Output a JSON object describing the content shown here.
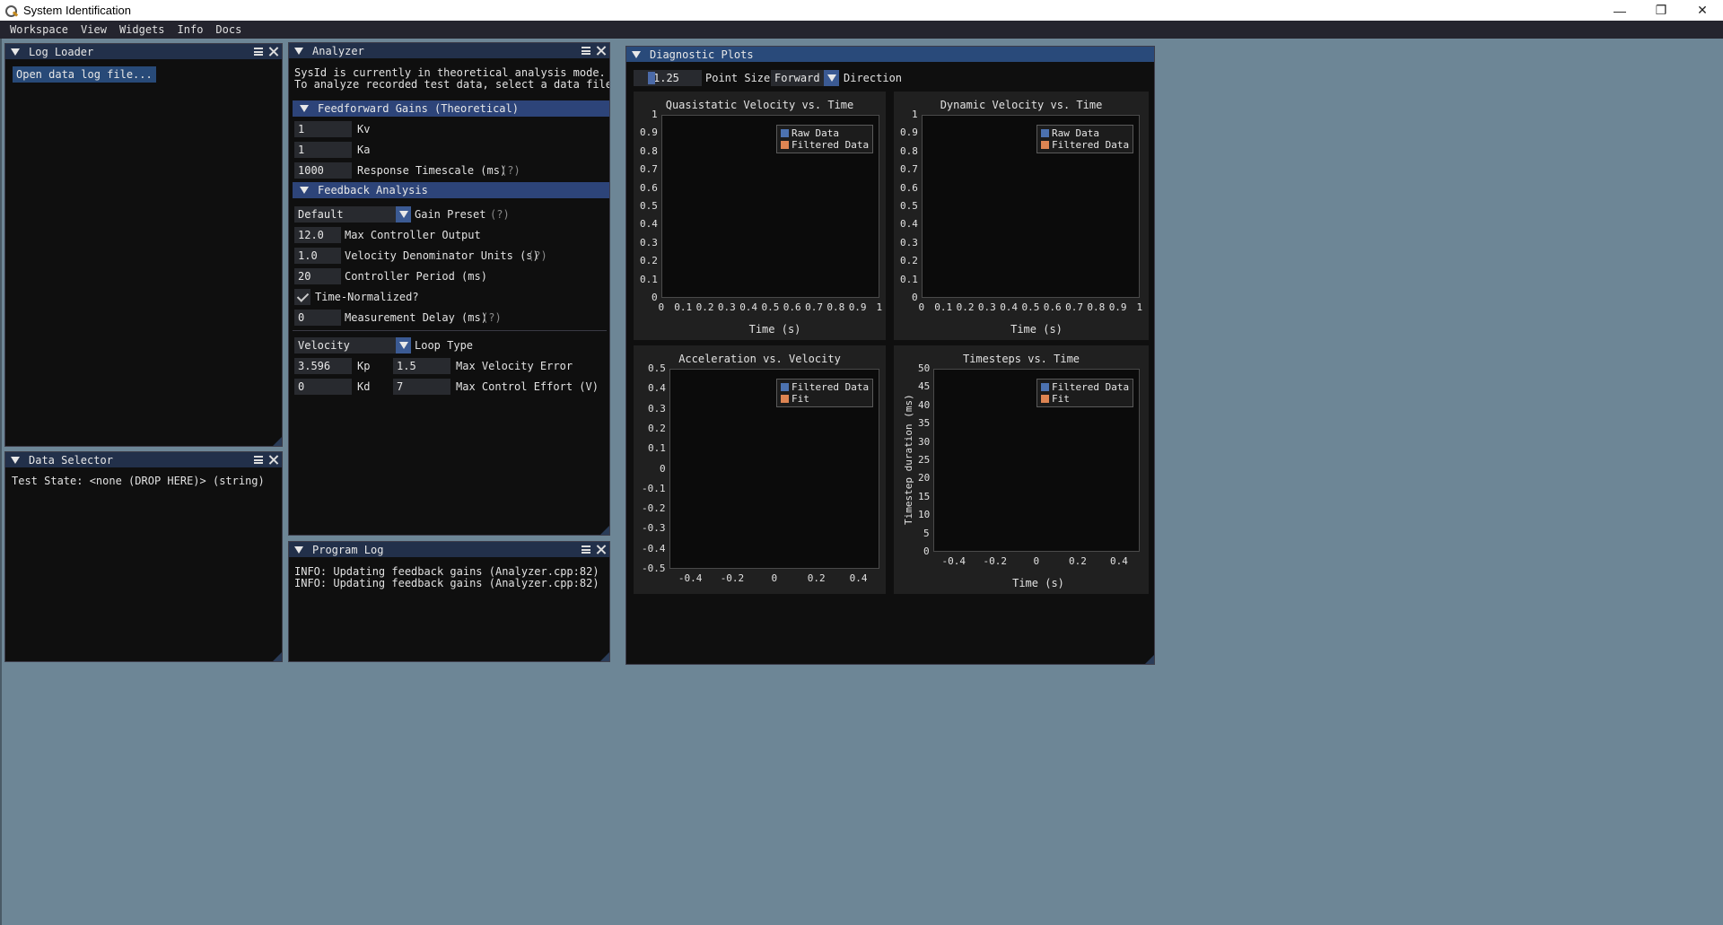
{
  "window": {
    "title": "System Identification",
    "controls": [
      "—",
      "❐",
      "✕"
    ]
  },
  "menu": [
    "Workspace",
    "View",
    "Widgets",
    "Info",
    "Docs"
  ],
  "log_loader": {
    "title": "Log Loader",
    "open_button": "Open data log file..."
  },
  "data_selector": {
    "title": "Data Selector",
    "test_state": "Test State: <none (DROP HERE)> (string)"
  },
  "analyzer": {
    "title": "Analyzer",
    "info_line1": "SysId is currently in theoretical analysis mode.",
    "info_line2": "To analyze recorded test data, select a data file (.wpil",
    "feedforward_header": "Feedforward Gains (Theoretical)",
    "kv": {
      "value": "1",
      "label": "Kv"
    },
    "ka": {
      "value": "1",
      "label": "Ka"
    },
    "response_timescale": {
      "value": "1000",
      "label": "Response Timescale (ms)",
      "help": "(?)"
    },
    "feedback_header": "Feedback Analysis",
    "gain_preset": {
      "value": "Default",
      "label": "Gain Preset",
      "help": "(?)"
    },
    "max_controller_output": {
      "value": "12.0",
      "label": "Max Controller Output"
    },
    "velocity_denominator": {
      "value": "1.0",
      "label": "Velocity Denominator Units (s)",
      "help": "(?)"
    },
    "controller_period": {
      "value": "20",
      "label": "Controller Period (ms)"
    },
    "time_normalized": {
      "label": "Time-Normalized?",
      "checked": true
    },
    "measurement_delay": {
      "value": "0",
      "label": "Measurement Delay (ms)",
      "help": "(?)"
    },
    "loop_type": {
      "value": "Velocity",
      "label": "Loop Type"
    },
    "kp": {
      "value": "3.596",
      "label": "Kp"
    },
    "kd": {
      "value": "0",
      "label": "Kd"
    },
    "max_velocity_error": {
      "value": "1.5",
      "label": "Max Velocity Error"
    },
    "max_control_effort": {
      "value": "7",
      "label": "Max Control Effort (V)"
    }
  },
  "program_log": {
    "title": "Program Log",
    "lines": [
      "INFO: Updating feedback gains (Analyzer.cpp:82)",
      "INFO: Updating feedback gains (Analyzer.cpp:82)"
    ]
  },
  "diagnostic": {
    "title": "Diagnostic Plots",
    "point_size": {
      "value": "1.25",
      "label": "Point Size"
    },
    "direction": {
      "value": "Forward",
      "label": "Direction"
    }
  },
  "colors": {
    "raw": "#4c72b0",
    "filtered": "#4c72b0",
    "filtered2": "#dd8452"
  },
  "chart_data": [
    {
      "type": "scatter",
      "title": "Quasistatic Velocity vs. Time",
      "xlabel": "Time (s)",
      "ylabel": "",
      "xticks": [
        "0",
        "0.1",
        "0.2",
        "0.3",
        "0.4",
        "0.5",
        "0.6",
        "0.7",
        "0.8",
        "0.9",
        "1"
      ],
      "yticks": [
        "0",
        "0.1",
        "0.2",
        "0.3",
        "0.4",
        "0.5",
        "0.6",
        "0.7",
        "0.8",
        "0.9",
        "1"
      ],
      "xlim": [
        0,
        1
      ],
      "ylim": [
        0,
        1
      ],
      "series": [
        {
          "name": "Raw Data",
          "x": [],
          "y": []
        },
        {
          "name": "Filtered Data",
          "x": [],
          "y": []
        }
      ],
      "legend": "top-right"
    },
    {
      "type": "scatter",
      "title": "Dynamic Velocity vs. Time",
      "xlabel": "Time (s)",
      "ylabel": "",
      "xticks": [
        "0",
        "0.1",
        "0.2",
        "0.3",
        "0.4",
        "0.5",
        "0.6",
        "0.7",
        "0.8",
        "0.9",
        "1"
      ],
      "yticks": [
        "0",
        "0.1",
        "0.2",
        "0.3",
        "0.4",
        "0.5",
        "0.6",
        "0.7",
        "0.8",
        "0.9",
        "1"
      ],
      "xlim": [
        0,
        1
      ],
      "ylim": [
        0,
        1
      ],
      "series": [
        {
          "name": "Raw Data",
          "x": [],
          "y": []
        },
        {
          "name": "Filtered Data",
          "x": [],
          "y": []
        }
      ],
      "legend": "top-right"
    },
    {
      "type": "scatter",
      "title": "Acceleration vs. Velocity",
      "xlabel": "",
      "ylabel": "",
      "xticks": [
        "-0.4",
        "-0.2",
        "0",
        "0.2",
        "0.4"
      ],
      "yticks": [
        "-0.5",
        "-0.4",
        "-0.3",
        "-0.2",
        "-0.1",
        "0",
        "0.1",
        "0.2",
        "0.3",
        "0.4",
        "0.5"
      ],
      "xlim": [
        -0.5,
        0.5
      ],
      "ylim": [
        -0.5,
        0.5
      ],
      "series": [
        {
          "name": "Filtered Data",
          "x": [],
          "y": []
        },
        {
          "name": "Fit",
          "x": [],
          "y": []
        }
      ],
      "legend": "top-right"
    },
    {
      "type": "scatter",
      "title": "Timesteps vs. Time",
      "xlabel": "Time (s)",
      "ylabel": "Timestep duration (ms)",
      "xticks": [
        "-0.4",
        "-0.2",
        "0",
        "0.2",
        "0.4"
      ],
      "yticks": [
        "0",
        "5",
        "10",
        "15",
        "20",
        "25",
        "30",
        "35",
        "40",
        "45",
        "50"
      ],
      "xlim": [
        -0.5,
        0.5
      ],
      "ylim": [
        0,
        50
      ],
      "series": [
        {
          "name": "Filtered Data",
          "x": [],
          "y": []
        },
        {
          "name": "Fit",
          "x": [],
          "y": []
        }
      ],
      "legend": "top-right"
    }
  ]
}
